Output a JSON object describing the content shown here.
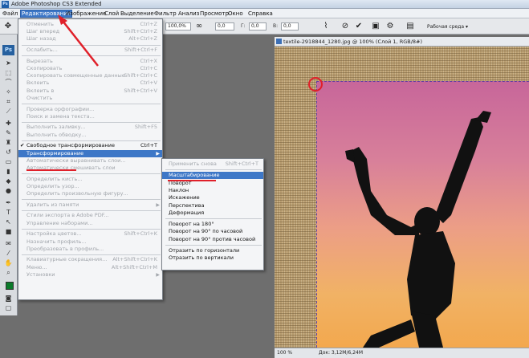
{
  "window": {
    "title": "Adobe Photoshop CS3 Extended",
    "logo": "Ps"
  },
  "menubar": {
    "items": [
      {
        "label": "Файл"
      },
      {
        "label": "Редактирование",
        "active": true
      },
      {
        "label": "Изображение"
      },
      {
        "label": "Слой"
      },
      {
        "label": "Выделение"
      },
      {
        "label": "Фильтр"
      },
      {
        "label": "Анализ"
      },
      {
        "label": "Просмотр"
      },
      {
        "label": "Окно"
      },
      {
        "label": "Справка"
      }
    ]
  },
  "options_bar": {
    "zoom_value": "100,0%",
    "angle_value": "0,0",
    "h_label": "Г:",
    "h_value": "0,0",
    "v_label": "В:",
    "v_value": "0,0",
    "workspace_label": "Рабочая среда"
  },
  "edit_menu": {
    "items": [
      {
        "label": "Отменить",
        "shortcut": "Ctrl+Z",
        "enabled": false
      },
      {
        "label": "Шаг вперед",
        "shortcut": "Shift+Ctrl+Z",
        "enabled": false
      },
      {
        "label": "Шаг назад",
        "shortcut": "Alt+Ctrl+Z",
        "enabled": false
      },
      {
        "sep": true
      },
      {
        "label": "Ослабить...",
        "shortcut": "Shift+Ctrl+F",
        "enabled": false
      },
      {
        "sep": true
      },
      {
        "label": "Вырезать",
        "shortcut": "Ctrl+X",
        "enabled": false
      },
      {
        "label": "Скопировать",
        "shortcut": "Ctrl+C",
        "enabled": false
      },
      {
        "label": "Скопировать совмещенные данные",
        "shortcut": "Shift+Ctrl+C",
        "enabled": false
      },
      {
        "label": "Вклеить",
        "shortcut": "Ctrl+V",
        "enabled": false
      },
      {
        "label": "Вклеить в",
        "shortcut": "Shift+Ctrl+V",
        "enabled": false
      },
      {
        "label": "Очистить",
        "shortcut": "",
        "enabled": false
      },
      {
        "sep": true
      },
      {
        "label": "Проверка орфографии...",
        "shortcut": "",
        "enabled": false
      },
      {
        "label": "Поиск и замена текста...",
        "shortcut": "",
        "enabled": false
      },
      {
        "sep": true
      },
      {
        "label": "Выполнить заливку...",
        "shortcut": "Shift+F5",
        "enabled": false
      },
      {
        "label": "Выполнить обводку...",
        "shortcut": "",
        "enabled": false
      },
      {
        "sep": true
      },
      {
        "label": "Свободное трансформирование",
        "shortcut": "Ctrl+T",
        "enabled": true,
        "checked": true
      },
      {
        "label": "Трансформирование",
        "shortcut": "",
        "enabled": true,
        "highlighted": true,
        "submenu": true
      },
      {
        "label": "Автоматически выравнивать слои...",
        "shortcut": "",
        "enabled": false
      },
      {
        "label": "Автоматически смешивать слои",
        "shortcut": "",
        "enabled": false
      },
      {
        "sep": true
      },
      {
        "label": "Определить кисть...",
        "shortcut": "",
        "enabled": false
      },
      {
        "label": "Определить узор...",
        "shortcut": "",
        "enabled": false
      },
      {
        "label": "Определить произвольную фигуру...",
        "shortcut": "",
        "enabled": false
      },
      {
        "sep": true
      },
      {
        "label": "Удалить из памяти",
        "shortcut": "",
        "enabled": false,
        "submenu": true
      },
      {
        "sep": true
      },
      {
        "label": "Стили экспорта в Adobe PDF...",
        "shortcut": "",
        "enabled": false
      },
      {
        "label": "Управление наборами...",
        "shortcut": "",
        "enabled": false
      },
      {
        "sep": true
      },
      {
        "label": "Настройка цветов...",
        "shortcut": "Shift+Ctrl+K",
        "enabled": false
      },
      {
        "label": "Назначить профиль...",
        "shortcut": "",
        "enabled": false
      },
      {
        "label": "Преобразовать в профиль...",
        "shortcut": "",
        "enabled": false
      },
      {
        "sep": true
      },
      {
        "label": "Клавиатурные сокращения...",
        "shortcut": "Alt+Shift+Ctrl+K",
        "enabled": false
      },
      {
        "label": "Меню...",
        "shortcut": "Alt+Shift+Ctrl+M",
        "enabled": false
      },
      {
        "label": "Установки",
        "shortcut": "",
        "enabled": false,
        "submenu": true
      }
    ]
  },
  "transform_submenu": {
    "items": [
      {
        "label": "Применить снова",
        "shortcut": "Shift+Ctrl+T",
        "enabled": false
      },
      {
        "sep": true
      },
      {
        "label": "Масштабирование",
        "highlighted": true,
        "enabled": true
      },
      {
        "label": "Поворот",
        "enabled": true
      },
      {
        "label": "Наклон",
        "enabled": true
      },
      {
        "label": "Искажение",
        "enabled": true
      },
      {
        "label": "Перспектива",
        "enabled": true
      },
      {
        "label": "Деформация",
        "enabled": true
      },
      {
        "sep": true
      },
      {
        "label": "Поворот на 180°",
        "enabled": true
      },
      {
        "label": "Поворот на 90° по часовой",
        "enabled": true
      },
      {
        "label": "Поворот на 90° против часовой",
        "enabled": true
      },
      {
        "sep": true
      },
      {
        "label": "Отразить по горизонтали",
        "enabled": true
      },
      {
        "label": "Отразить по вертикали",
        "enabled": true
      }
    ]
  },
  "document": {
    "tab_title": "textile-2918844_1280.jpg @ 100% (Слой 1, RGB/8#)",
    "status_zoom": "100 %",
    "status_doc": "Док: 3,12M/6,24M"
  },
  "colors": {
    "accent": "#3d77c7",
    "annotation": "#e0202a",
    "foreground_swatch": "#0b7a2a"
  }
}
